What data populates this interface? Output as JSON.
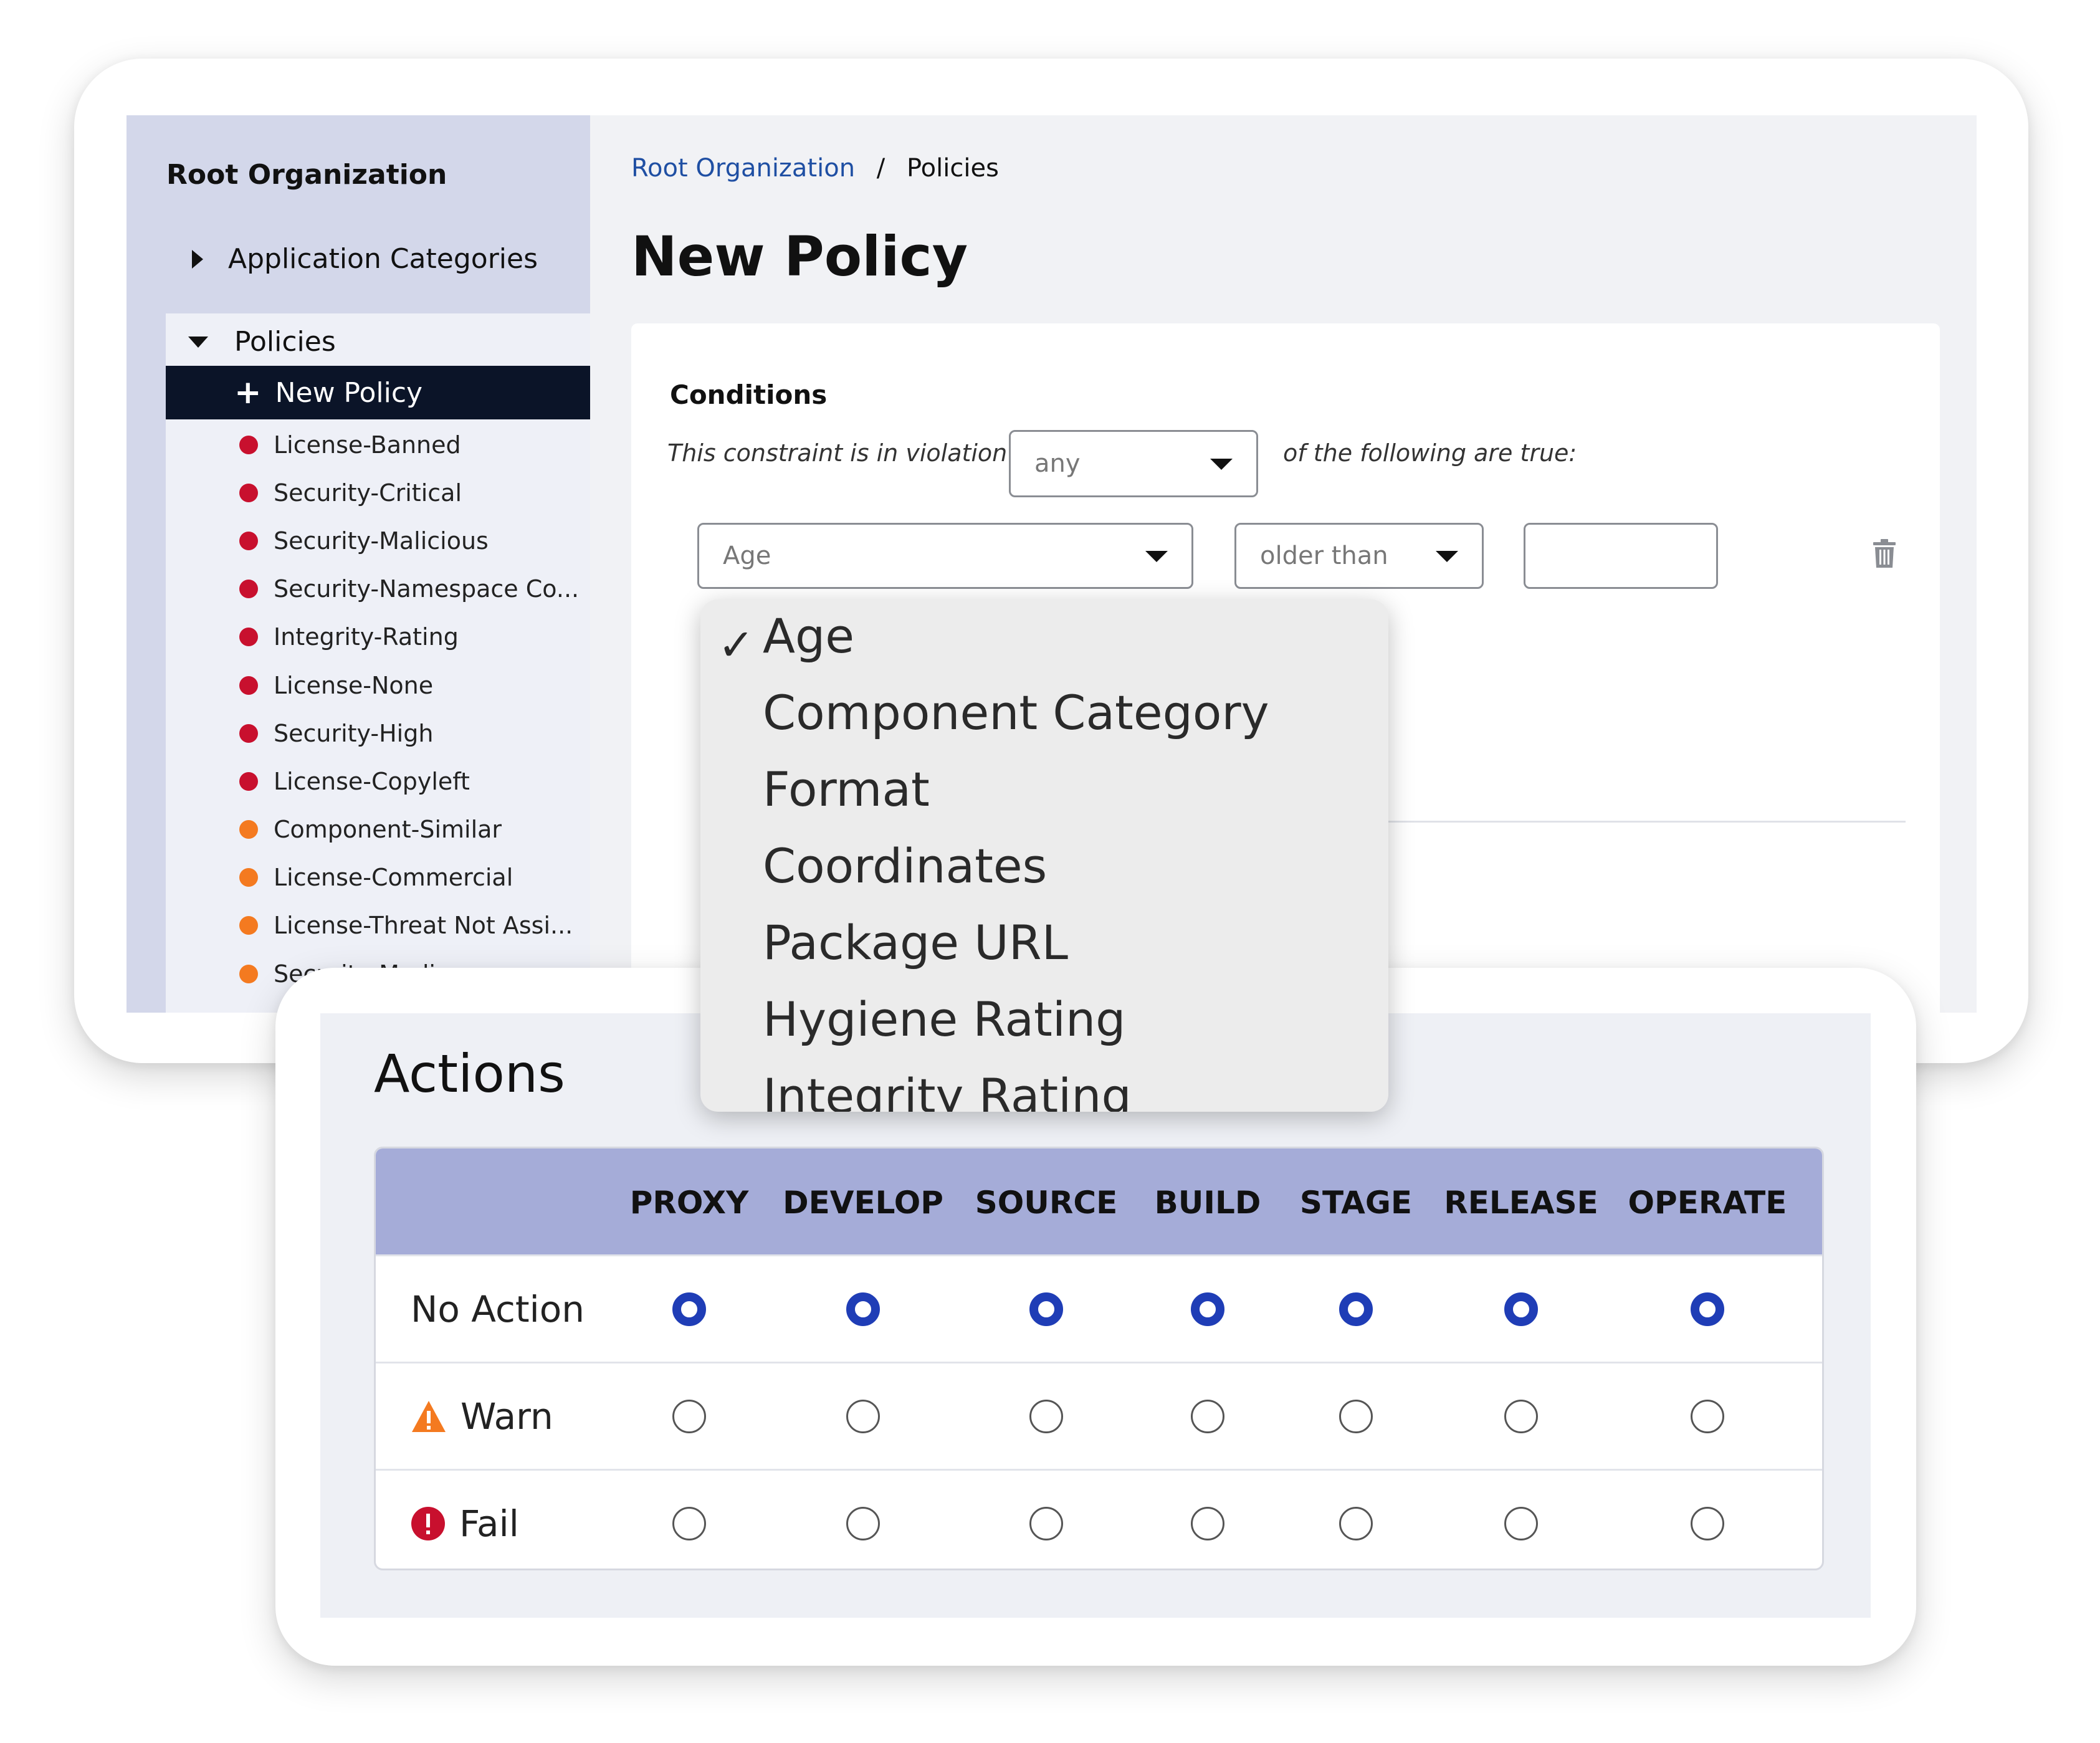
{
  "sidebar": {
    "org_title": "Root Organization",
    "application_categories": "Application Categories",
    "policies_header": "Policies",
    "new_policy": "New Policy",
    "items": [
      {
        "label": "License-Banned",
        "color": "#c8102e"
      },
      {
        "label": "Security-Critical",
        "color": "#c8102e"
      },
      {
        "label": "Security-Malicious",
        "color": "#c8102e"
      },
      {
        "label": "Security-Namespace Co...",
        "color": "#c8102e"
      },
      {
        "label": "Integrity-Rating",
        "color": "#c8102e"
      },
      {
        "label": "License-None",
        "color": "#c8102e"
      },
      {
        "label": "Security-High",
        "color": "#c8102e"
      },
      {
        "label": "License-Copyleft",
        "color": "#c8102e"
      },
      {
        "label": "Component-Similar",
        "color": "#f47a20"
      },
      {
        "label": "License-Commercial",
        "color": "#f47a20"
      },
      {
        "label": "License-Threat Not Assi...",
        "color": "#f47a20"
      },
      {
        "label": "Security-Medium",
        "color": "#f47a20"
      }
    ]
  },
  "breadcrumb": {
    "parent": "Root Organization",
    "separator": "/",
    "current": "Policies"
  },
  "page_title": "New Policy",
  "conditions": {
    "title": "Conditions",
    "prefix_text": "This constraint is in violation if",
    "match_value": "any",
    "suffix_text": "of the following are true:",
    "field_value": "Age",
    "operator_value": "older than",
    "value_input": ""
  },
  "dropdown": {
    "selected": "Age",
    "options": [
      "Age",
      "Component Category",
      "Format",
      "Coordinates",
      "Package URL",
      "Hygiene Rating",
      "Integrity Rating"
    ]
  },
  "actions": {
    "title": "Actions",
    "columns": [
      "PROXY",
      "DEVELOP",
      "SOURCE",
      "BUILD",
      "STAGE",
      "RELEASE",
      "OPERATE"
    ],
    "rows": [
      {
        "label": "No Action",
        "icon": "",
        "selected": [
          true,
          true,
          true,
          true,
          true,
          true,
          true
        ]
      },
      {
        "label": "Warn",
        "icon": "warning-icon",
        "selected": [
          false,
          false,
          false,
          false,
          false,
          false,
          false
        ]
      },
      {
        "label": "Fail",
        "icon": "error-icon",
        "selected": [
          false,
          false,
          false,
          false,
          false,
          false,
          false
        ]
      }
    ]
  },
  "colors": {
    "critical": "#c8102e",
    "medium": "#f47a20",
    "selected_radio": "#1f3db6",
    "table_header": "#a5acd8",
    "link": "#1f4fa3"
  }
}
